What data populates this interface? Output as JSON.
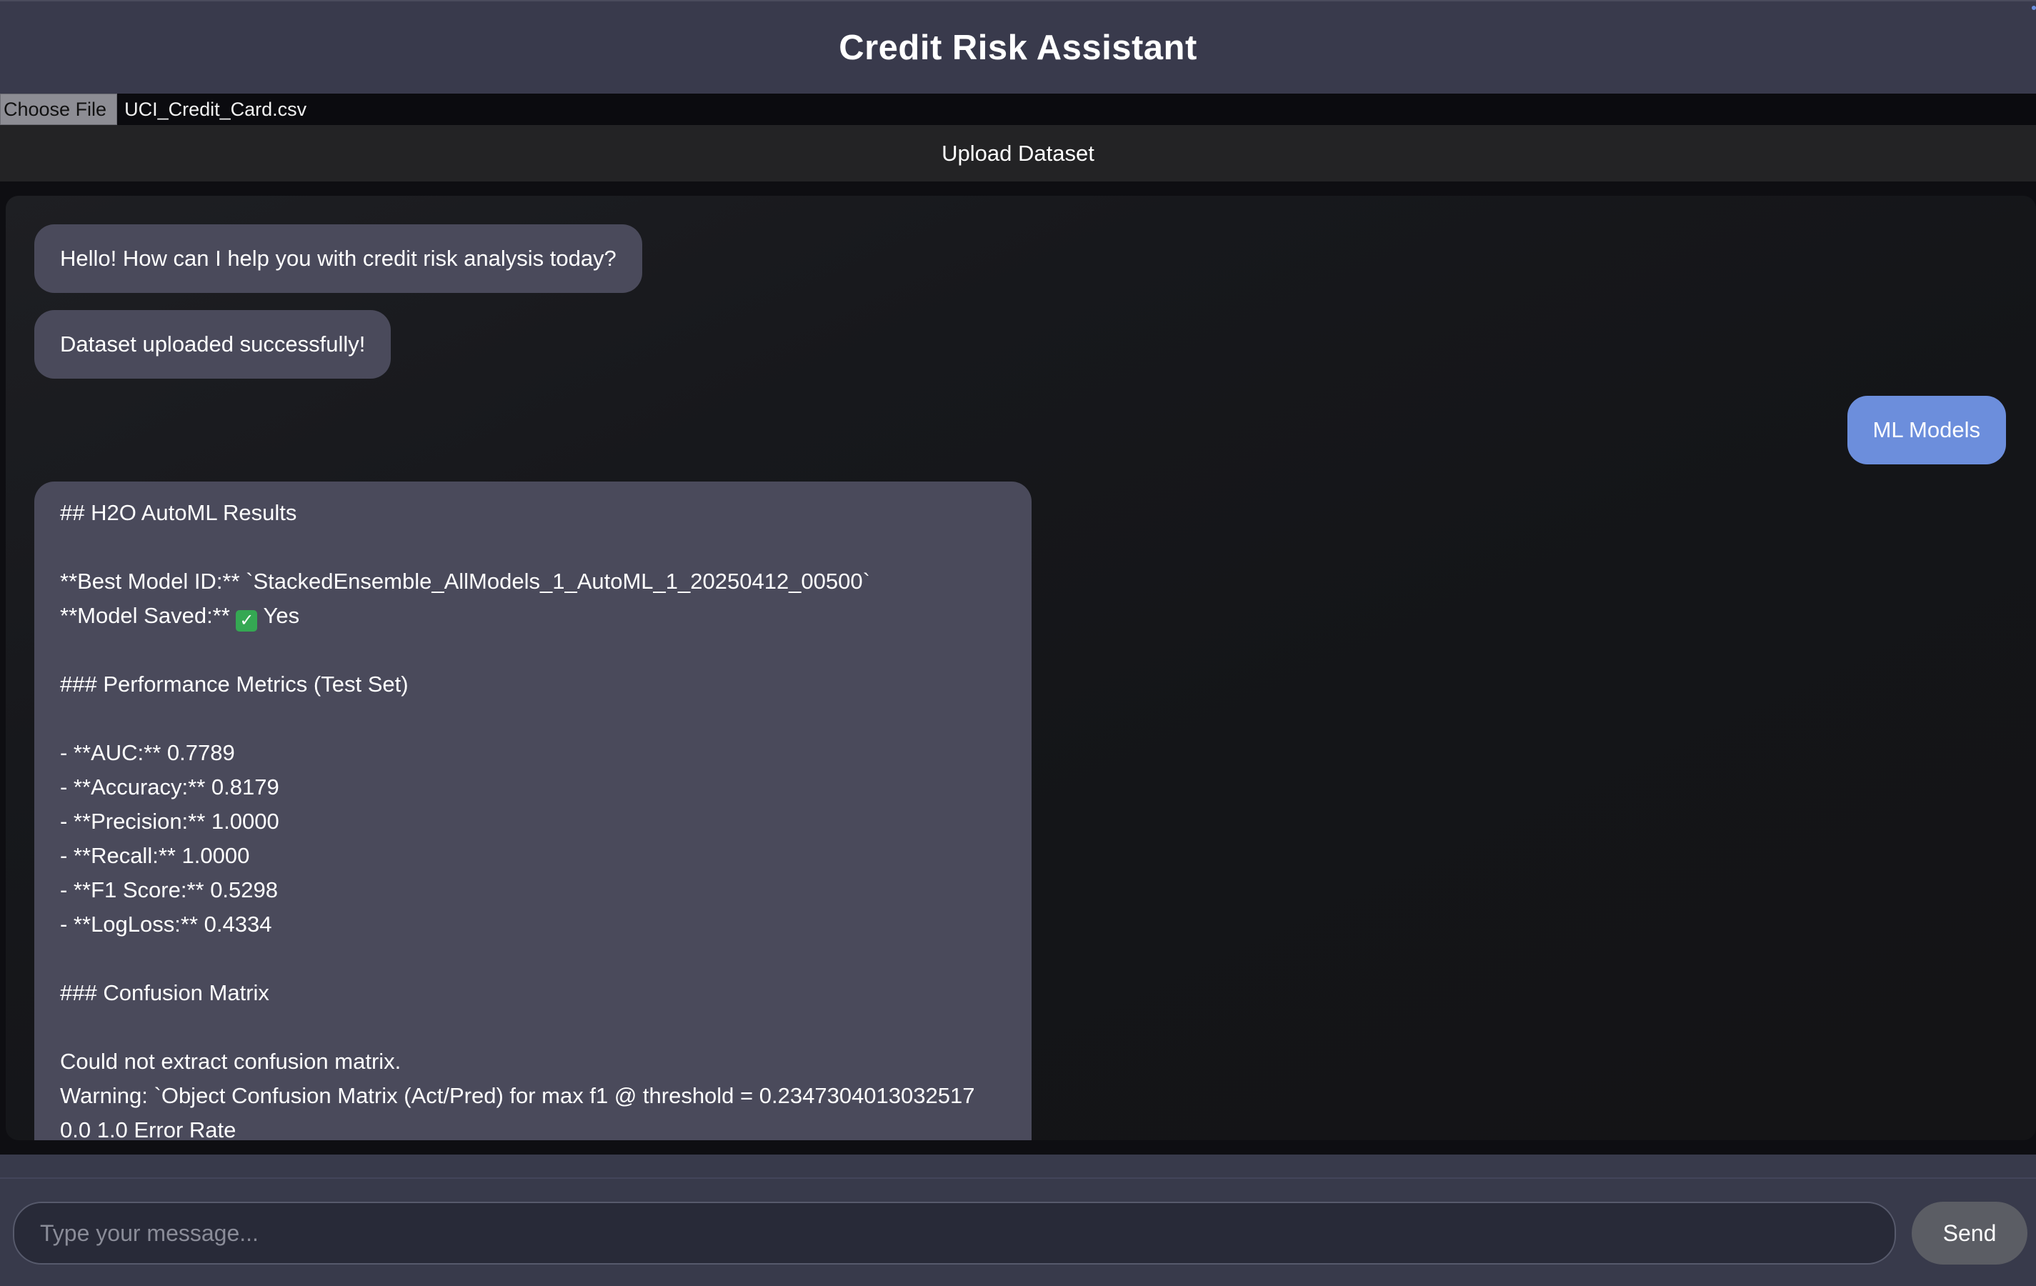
{
  "app": {
    "title": "Credit Risk Assistant"
  },
  "upload": {
    "choose_file_label": "Choose File",
    "file_name": "UCI_Credit_Card.csv",
    "upload_button_label": "Upload Dataset"
  },
  "chat": {
    "messages": [
      {
        "role": "bot",
        "text": "Hello! How can I help you with credit risk analysis today?"
      },
      {
        "role": "bot",
        "text": "Dataset uploaded successfully!"
      },
      {
        "role": "user",
        "text": "ML Models"
      },
      {
        "role": "bot",
        "lines": [
          "## H2O AutoML Results",
          "",
          "**Best Model ID:** `StackedEnsemble_AllModels_1_AutoML_1_20250412_00500`",
          "**Model Saved:** ",
          "",
          "### Performance Metrics (Test Set)",
          "",
          "- **AUC:** 0.7789",
          "- **Accuracy:** 0.8179",
          "- **Precision:** 1.0000",
          "- **Recall:** 1.0000",
          "- **F1 Score:** 0.5298",
          "- **LogLoss:** 0.4334",
          "",
          "### Confusion Matrix",
          "",
          "Could not extract confusion matrix.",
          "Warning: `Object Confusion Matrix (Act/Pred) for max f1 @ threshold = 0.2347304013032517",
          "0.0 1.0 Error Rate"
        ],
        "model_saved_value": "Yes"
      }
    ]
  },
  "composer": {
    "placeholder": "Type your message...",
    "value": "",
    "send_label": "Send"
  }
}
